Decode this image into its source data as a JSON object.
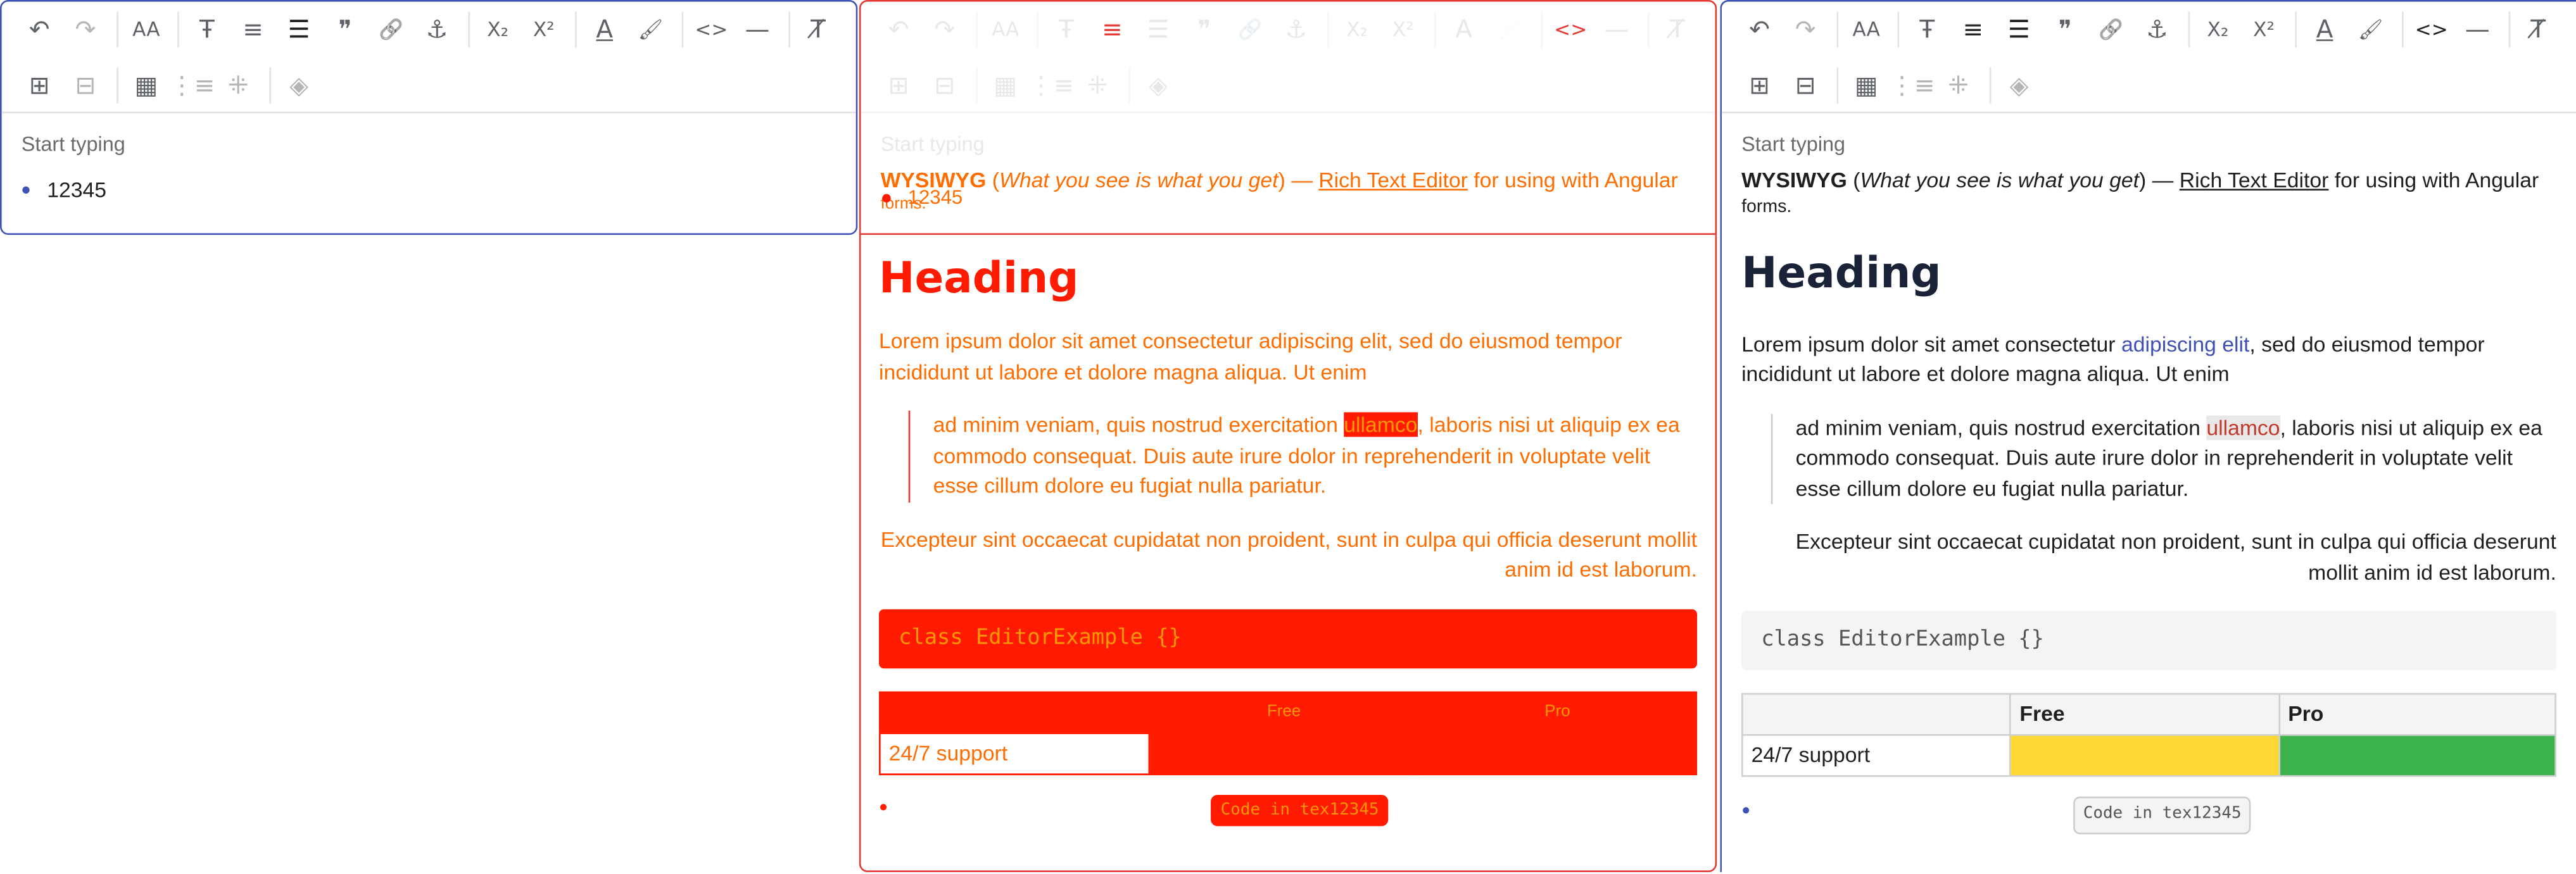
{
  "toolbar": {
    "row1": [
      "undo-icon",
      "redo-icon",
      "font-size-icon",
      "text-style-icon",
      "align-icon",
      "bullet-list-icon",
      "blockquote-icon",
      "link-icon",
      "anchor-icon",
      "subscript-icon",
      "superscript-icon",
      "text-color-icon",
      "highlight-icon",
      "code-icon",
      "horizontal-rule-icon",
      "clear-format-icon"
    ],
    "row2": [
      "insert-row-icon",
      "remove-icon",
      "table-icon",
      "insert-column-icon",
      "delete-table-icon",
      "fill-color-icon"
    ],
    "glyphs": {
      "undo": "↶",
      "redo": "↷",
      "font_size": "AA",
      "text_style": "Ŧ",
      "align": "≡",
      "list": "☰",
      "quote": "❞",
      "link": "🔗",
      "anchor": "⚓",
      "sub": "X₂",
      "sup": "X²",
      "color": "A",
      "brush": "🖌",
      "code": "<>",
      "rule": "—",
      "clear": "T̸"
    }
  },
  "panel_a": {
    "placeholder": "Start typing",
    "bullet": "•",
    "item": "12345"
  },
  "panel_b": {
    "placeholder": "Start typing",
    "bullet_item": "12345",
    "wysiwyg_bold": "WYSIWYG",
    "wysiwyg_italic": "What you see is what you get",
    "dash": "—",
    "link": "Rich Text Editor",
    "tail": "for using with Angular",
    "tail2": "forms.",
    "heading": "Heading",
    "para": "Lorem ipsum dolor sit amet consectetur adipiscing elit, sed do eiusmod tempor incididunt ut labore et dolore magna aliqua. Ut enim",
    "quote_a": "ad minim veniam, quis nostrud exercitation ",
    "quote_hl": "ullamco",
    "quote_b": ", laboris nisi ut aliquip ex ea commodo consequat. Duis aute irure dolor in reprehenderit in voluptate velit esse cillum dolore eu fugiat nulla pariatur.",
    "right": "Excepteur sint occaecat cupidatat non proident, sunt in culpa qui officia deserunt mollit anim id est laborum.",
    "code": "class EditorExample {}",
    "table_head": [
      "",
      "Free",
      "Pro"
    ],
    "table_row": [
      "24/7 support",
      "",
      ""
    ],
    "inline_code": "Code in tex12345"
  },
  "panel_c": {
    "placeholder": "Start typing",
    "wysiwyg_bold": "WYSIWYG",
    "wysiwyg_italic": "What you see is what you get",
    "dash": "—",
    "link": "Rich Text Editor",
    "tail": "for using with Angular",
    "tail2": "forms.",
    "heading": "Heading",
    "para_a": "Lorem ipsum dolor sit amet consectetur ",
    "para_link": "adipiscing elit",
    "para_b": ", sed do eiusmod tempor incididunt ut labore et dolore magna aliqua. Ut enim",
    "quote_a": "ad minim veniam, quis nostrud exercitation ",
    "quote_hl": "ullamco",
    "quote_b": ", laboris nisi ut aliquip ex ea commodo consequat. Duis aute irure dolor in reprehenderit in voluptate velit esse cillum dolore eu fugiat nulla pariatur.",
    "right": "Excepteur sint occaecat cupidatat non proident, sunt in culpa qui officia deserunt mollit anim id est laborum.",
    "code": "class EditorExample {}",
    "table_head": [
      "",
      "Free",
      "Pro"
    ],
    "table_row": [
      "24/7 support",
      "",
      ""
    ],
    "inline_code": "Code in tex12345"
  },
  "colors": {
    "accent_blue": "#3f51b5",
    "red": "#e53935",
    "orange_text": "#ff6d00",
    "yellow_cell": "#fdd835",
    "green_cell": "#3cb44b",
    "heading_dark": "#1a2238"
  }
}
